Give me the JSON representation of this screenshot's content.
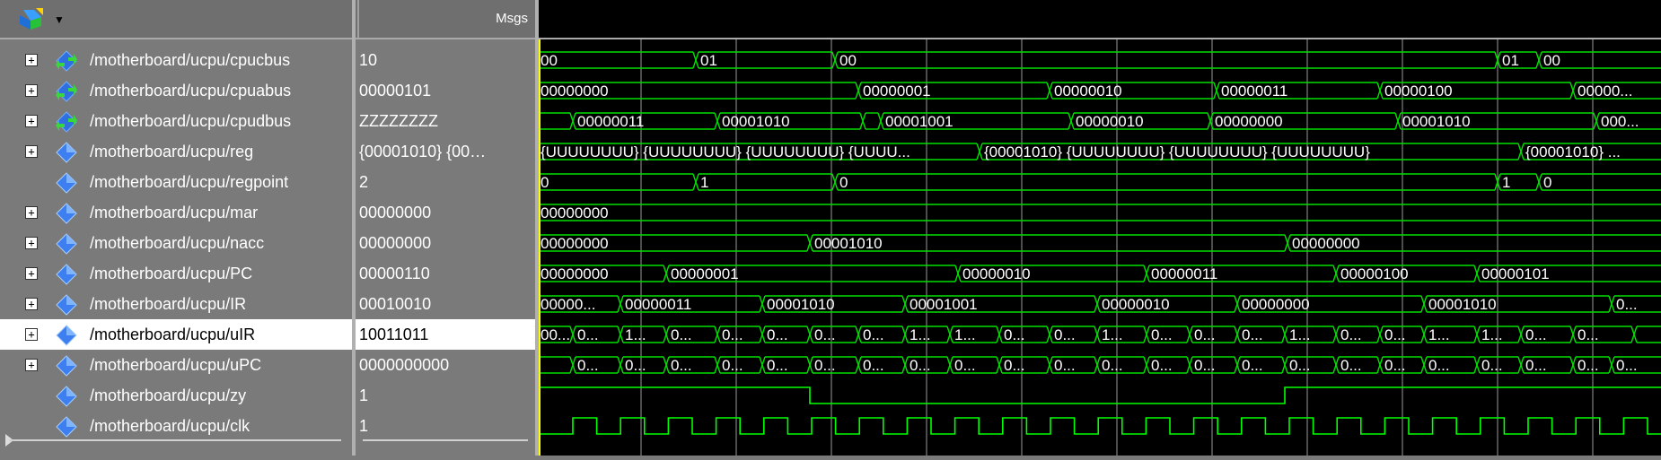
{
  "header": {
    "msgs_label": "Msgs"
  },
  "signals": [
    {
      "name": "/motherboard/ucpu/cpucbus",
      "value": "10",
      "expandable": true,
      "icon": "bus-inout-icon"
    },
    {
      "name": "/motherboard/ucpu/cpuabus",
      "value": "00000101",
      "expandable": true,
      "icon": "bus-inout-icon"
    },
    {
      "name": "/motherboard/ucpu/cpudbus",
      "value": "ZZZZZZZZ",
      "expandable": true,
      "icon": "bus-inout-icon"
    },
    {
      "name": "/motherboard/ucpu/reg",
      "value": "{00001010} {00…",
      "expandable": true,
      "icon": "signal-diamond-icon"
    },
    {
      "name": "/motherboard/ucpu/regpoint",
      "value": "2",
      "expandable": false,
      "icon": "signal-diamond-icon"
    },
    {
      "name": "/motherboard/ucpu/mar",
      "value": "00000000",
      "expandable": true,
      "icon": "signal-diamond-icon"
    },
    {
      "name": "/motherboard/ucpu/nacc",
      "value": "00000000",
      "expandable": true,
      "icon": "signal-diamond-icon"
    },
    {
      "name": "/motherboard/ucpu/PC",
      "value": "00000110",
      "expandable": true,
      "icon": "signal-diamond-icon"
    },
    {
      "name": "/motherboard/ucpu/IR",
      "value": "00010010",
      "expandable": true,
      "icon": "signal-diamond-icon"
    },
    {
      "name": "/motherboard/ucpu/uIR",
      "value": "10011011",
      "expandable": true,
      "icon": "signal-diamond-icon",
      "selected": true
    },
    {
      "name": "/motherboard/ucpu/uPC",
      "value": "0000000000",
      "expandable": true,
      "icon": "signal-diamond-icon"
    },
    {
      "name": "/motherboard/ucpu/zy",
      "value": "1",
      "expandable": false,
      "icon": "signal-diamond-icon"
    },
    {
      "name": "/motherboard/ucpu/clk",
      "value": "1",
      "expandable": false,
      "icon": "signal-diamond-icon"
    }
  ],
  "bus_waves": [
    {
      "segments": [
        {
          "t": 0,
          "label": "00"
        },
        {
          "t": 175,
          "label": "01"
        },
        {
          "t": 330,
          "label": "00"
        },
        {
          "t": 1068,
          "label": "01"
        },
        {
          "t": 1114,
          "label": "00"
        }
      ]
    },
    {
      "segments": [
        {
          "t": 0,
          "label": "00000000"
        },
        {
          "t": 356,
          "label": "00000001"
        },
        {
          "t": 569,
          "label": "00000010"
        },
        {
          "t": 755,
          "label": "00000011"
        },
        {
          "t": 937,
          "label": "00000100"
        },
        {
          "t": 1152,
          "label": "00000..."
        }
      ]
    },
    {
      "segments": [
        {
          "t": 0,
          "label": ""
        },
        {
          "t": 38,
          "label": "00000011"
        },
        {
          "t": 199,
          "label": "00001010"
        },
        {
          "t": 361,
          "label": ""
        },
        {
          "t": 381,
          "label": "00001001"
        },
        {
          "t": 593,
          "label": "00000010"
        },
        {
          "t": 748,
          "label": "00000000"
        },
        {
          "t": 957,
          "label": "00001010"
        },
        {
          "t": 1178,
          "label": "000..."
        }
      ]
    },
    {
      "segments": [
        {
          "t": 0,
          "label": "{UUUUUUUU} {UUUUUUUU} {UUUUUUUU} {UUUU..."
        },
        {
          "t": 491,
          "label": "{00001010} {UUUUUUUU} {UUUUUUUU} {UUUUUUUU}"
        },
        {
          "t": 1094,
          "label": "{00001010} ..."
        }
      ]
    },
    {
      "segments": [
        {
          "t": 0,
          "label": "0"
        },
        {
          "t": 175,
          "label": "1"
        },
        {
          "t": 330,
          "label": "0"
        },
        {
          "t": 1068,
          "label": "1"
        },
        {
          "t": 1114,
          "label": "0"
        }
      ]
    },
    {
      "segments": [
        {
          "t": 0,
          "label": "00000000"
        }
      ]
    },
    {
      "segments": [
        {
          "t": 0,
          "label": "00000000"
        },
        {
          "t": 302,
          "label": "00001010"
        },
        {
          "t": 834,
          "label": "00000000"
        }
      ]
    },
    {
      "segments": [
        {
          "t": 0,
          "label": "00000000"
        },
        {
          "t": 142,
          "label": "00000001"
        },
        {
          "t": 467,
          "label": "00000010"
        },
        {
          "t": 677,
          "label": "00000011"
        },
        {
          "t": 888,
          "label": "00000100"
        },
        {
          "t": 1045,
          "label": "00000101"
        }
      ]
    },
    {
      "segments": [
        {
          "t": 0,
          "label": "00000..."
        },
        {
          "t": 91,
          "label": "00000011"
        },
        {
          "t": 249,
          "label": "00001010"
        },
        {
          "t": 408,
          "label": "00001001"
        },
        {
          "t": 622,
          "label": "00000010"
        },
        {
          "t": 778,
          "label": "00000000"
        },
        {
          "t": 986,
          "label": "00001010"
        },
        {
          "t": 1195,
          "label": "0..."
        }
      ]
    },
    {
      "segments": [
        {
          "t": 0,
          "label": "00..."
        },
        {
          "t": 38,
          "label": "0..."
        },
        {
          "t": 91,
          "label": "1..."
        },
        {
          "t": 142,
          "label": "0..."
        },
        {
          "t": 199,
          "label": "0..."
        },
        {
          "t": 249,
          "label": "0..."
        },
        {
          "t": 302,
          "label": "0..."
        },
        {
          "t": 356,
          "label": "0..."
        },
        {
          "t": 408,
          "label": "1..."
        },
        {
          "t": 458,
          "label": "1..."
        },
        {
          "t": 513,
          "label": "0..."
        },
        {
          "t": 569,
          "label": "0..."
        },
        {
          "t": 622,
          "label": "1..."
        },
        {
          "t": 677,
          "label": "0..."
        },
        {
          "t": 725,
          "label": "0..."
        },
        {
          "t": 778,
          "label": "0..."
        },
        {
          "t": 831,
          "label": "1..."
        },
        {
          "t": 888,
          "label": "0..."
        },
        {
          "t": 937,
          "label": "0..."
        },
        {
          "t": 986,
          "label": "1..."
        },
        {
          "t": 1045,
          "label": "1..."
        },
        {
          "t": 1094,
          "label": "0..."
        },
        {
          "t": 1152,
          "label": "0..."
        },
        {
          "t": 1220,
          "label": ""
        }
      ]
    },
    {
      "segments": [
        {
          "t": 0,
          "label": ""
        },
        {
          "t": 38,
          "label": "0..."
        },
        {
          "t": 91,
          "label": "0..."
        },
        {
          "t": 142,
          "label": "0..."
        },
        {
          "t": 199,
          "label": "0..."
        },
        {
          "t": 249,
          "label": "0..."
        },
        {
          "t": 302,
          "label": "0..."
        },
        {
          "t": 356,
          "label": "0..."
        },
        {
          "t": 408,
          "label": "0..."
        },
        {
          "t": 458,
          "label": "0..."
        },
        {
          "t": 513,
          "label": "0..."
        },
        {
          "t": 569,
          "label": "0..."
        },
        {
          "t": 622,
          "label": "0..."
        },
        {
          "t": 677,
          "label": "0..."
        },
        {
          "t": 725,
          "label": "0..."
        },
        {
          "t": 778,
          "label": "0..."
        },
        {
          "t": 831,
          "label": "0..."
        },
        {
          "t": 888,
          "label": "0..."
        },
        {
          "t": 937,
          "label": "0..."
        },
        {
          "t": 986,
          "label": "0..."
        },
        {
          "t": 1045,
          "label": "0..."
        },
        {
          "t": 1094,
          "label": "0..."
        },
        {
          "t": 1152,
          "label": "0..."
        },
        {
          "t": 1195,
          "label": "0..."
        }
      ]
    }
  ],
  "zy_wave": {
    "transitions": [
      {
        "t": 0,
        "level": 1
      },
      {
        "t": 302,
        "level": 0
      },
      {
        "t": 831,
        "level": 1
      }
    ]
  },
  "clk_wave": {
    "period": 53.2,
    "first_rise": 38
  },
  "colors": {
    "wave": "#00ff00",
    "bus_line": "#00e000",
    "cursor": "#ffff00",
    "grid": "#9a9a9a",
    "background": "#000000"
  }
}
